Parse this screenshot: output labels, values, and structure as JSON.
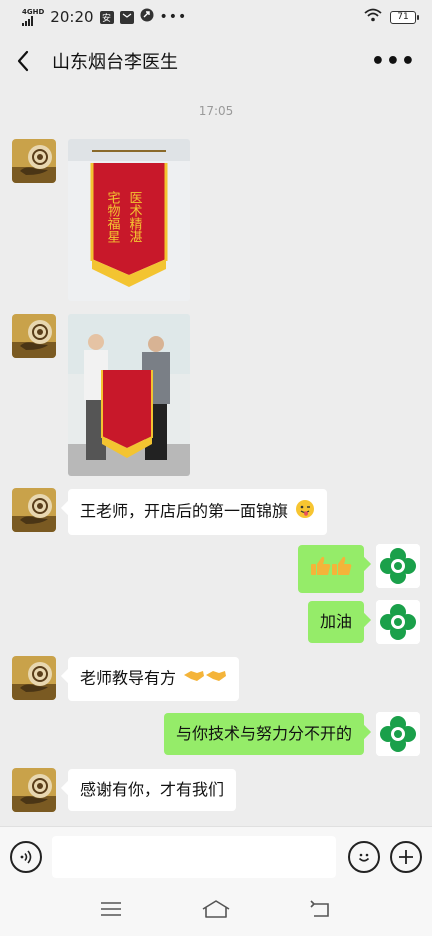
{
  "status_bar": {
    "network": "4GHD",
    "time": "20:20",
    "icon1": "安",
    "battery": "71",
    "icons": [
      "signal-icon",
      "shield-icon",
      "mail-icon",
      "app-icon",
      "more-dots-icon",
      "wifi-icon",
      "battery-icon"
    ]
  },
  "header": {
    "title": "山东烟台李医生",
    "back_icon": "chevron-left-icon",
    "more_icon": "more-dots-icon"
  },
  "chat": {
    "timestamp": "17:05",
    "messages": [
      {
        "side": "in",
        "type": "image",
        "content": "banner-photo"
      },
      {
        "side": "in",
        "type": "image",
        "content": "two-men-banner-photo"
      },
      {
        "side": "in",
        "type": "text",
        "text": "王老师，开店后的第一面锦旗",
        "emoji": "winking-tongue-emoji"
      },
      {
        "side": "out",
        "type": "emoji",
        "emoji": "thumbs-up-emoji x2"
      },
      {
        "side": "out",
        "type": "text",
        "text": "加油"
      },
      {
        "side": "in",
        "type": "text",
        "text": "老师教导有方",
        "emoji": "handshake-emoji x2"
      },
      {
        "side": "out",
        "type": "text",
        "text": "与你技术与努力分不开的"
      },
      {
        "side": "in",
        "type": "text",
        "text": "感谢有你，才有我们"
      }
    ]
  },
  "banner": {
    "right_col": "医术精湛",
    "left_col": "宅物福星"
  },
  "colors": {
    "background": "#ededed",
    "outgoing_bubble": "#95ec69",
    "incoming_bubble": "#ffffff",
    "banner_red": "#c8182a",
    "banner_gold": "#f3c431"
  }
}
